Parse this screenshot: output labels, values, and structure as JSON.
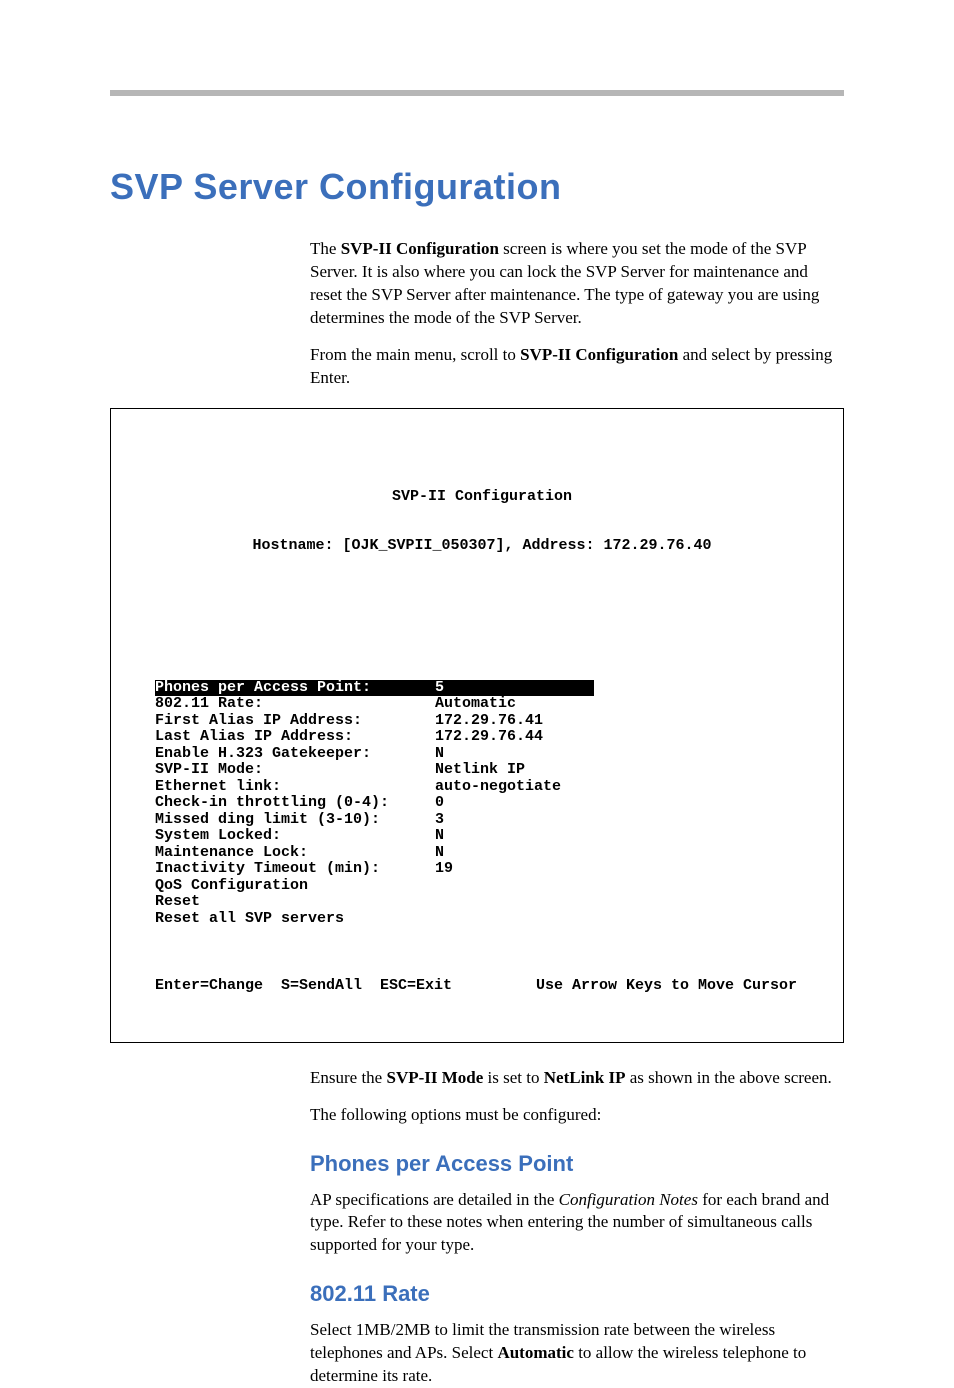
{
  "heading": "SVP Server Configuration",
  "intro": {
    "p1_prefix": "The ",
    "p1_bold": "SVP-II Configuration",
    "p1_rest": " screen is where you set the mode of the SVP Server. It is also where you can lock the SVP Server for maintenance and reset the SVP Server after maintenance. The type of gateway you are using determines the mode of the SVP Server.",
    "p2_prefix": "From the main menu, scroll to ",
    "p2_bold": "SVP-II Configuration",
    "p2_rest": " and select by pressing Enter."
  },
  "terminal": {
    "title": "SVP-II Configuration",
    "hostline": "Hostname: [OJK_SVPII_050307], Address: 172.29.76.40",
    "rows": [
      {
        "label": "Phones per Access Point:",
        "value": "5",
        "highlight": true
      },
      {
        "label": "802.11 Rate:",
        "value": "Automatic"
      },
      {
        "label": "First Alias IP Address:",
        "value": "172.29.76.41"
      },
      {
        "label": "Last Alias IP Address:",
        "value": "172.29.76.44"
      },
      {
        "label": "Enable H.323 Gatekeeper:",
        "value": "N"
      },
      {
        "label": "SVP-II Mode:",
        "value": "Netlink IP"
      },
      {
        "label": "Ethernet link:",
        "value": "auto-negotiate"
      },
      {
        "label": "Check-in throttling (0-4):",
        "value": "0"
      },
      {
        "label": "Missed ding limit (3-10):",
        "value": "3"
      },
      {
        "label": "System Locked:",
        "value": "N"
      },
      {
        "label": "Maintenance Lock:",
        "value": "N"
      },
      {
        "label": "Inactivity Timeout (min):",
        "value": "19"
      },
      {
        "label": "QoS Configuration",
        "value": ""
      },
      {
        "label": "Reset",
        "value": ""
      },
      {
        "label": "Reset all SVP servers",
        "value": ""
      }
    ],
    "footer_left": "Enter=Change  S=SendAll  ESC=Exit",
    "footer_right": "Use Arrow Keys to Move Cursor"
  },
  "after_terminal": {
    "p1_prefix": "Ensure the ",
    "p1_bold1": "SVP-II Mode",
    "p1_mid": " is set to ",
    "p1_bold2": "NetLink IP",
    "p1_rest": " as shown in the above screen.",
    "p2": "The following options must be configured:"
  },
  "sections": {
    "s1_title": "Phones per Access Point",
    "s1_p1_prefix": "AP specifications are detailed in the ",
    "s1_p1_italic": "Configuration Notes",
    "s1_p1_rest": " for each brand and type. Refer to these notes when entering the number of simultaneous calls supported for your type.",
    "s2_title": "802.11 Rate",
    "s2_p1_prefix": "Select 1MB/2MB to limit the transmission rate between the wireless telephones and APs. Select ",
    "s2_p1_bold": "Automatic",
    "s2_p1_rest": " to allow the wireless telephone to determine its rate."
  }
}
